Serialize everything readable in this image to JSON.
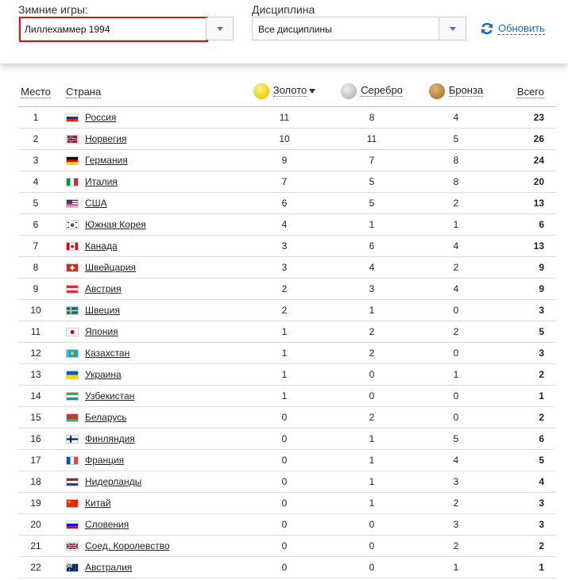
{
  "filters": {
    "games_label": "Зимние игры:",
    "games_value": "Лиллехаммер 1994",
    "discipline_label": "Дисциплина",
    "discipline_value": "Все дисциплины",
    "refresh_label": "Обновить"
  },
  "table": {
    "headers": {
      "place": "Место",
      "country": "Страна",
      "gold": "Золото",
      "silver": "Серебро",
      "bronze": "Бронза",
      "total": "Всего"
    },
    "rows": [
      {
        "place": "1",
        "country": "Россия",
        "flag": "russia",
        "gold": "11",
        "silver": "8",
        "bronze": "4",
        "total": "23"
      },
      {
        "place": "2",
        "country": "Норвегия",
        "flag": "norway",
        "gold": "10",
        "silver": "11",
        "bronze": "5",
        "total": "26"
      },
      {
        "place": "3",
        "country": "Германия",
        "flag": "germany",
        "gold": "9",
        "silver": "7",
        "bronze": "8",
        "total": "24"
      },
      {
        "place": "4",
        "country": "Италия",
        "flag": "italy",
        "gold": "7",
        "silver": "5",
        "bronze": "8",
        "total": "20"
      },
      {
        "place": "5",
        "country": "США",
        "flag": "usa",
        "gold": "6",
        "silver": "5",
        "bronze": "2",
        "total": "13"
      },
      {
        "place": "6",
        "country": "Южная Корея",
        "flag": "south-korea",
        "gold": "4",
        "silver": "1",
        "bronze": "1",
        "total": "6"
      },
      {
        "place": "7",
        "country": "Канада",
        "flag": "canada",
        "gold": "3",
        "silver": "6",
        "bronze": "4",
        "total": "13"
      },
      {
        "place": "8",
        "country": "Швейцария",
        "flag": "switzerland",
        "gold": "3",
        "silver": "4",
        "bronze": "2",
        "total": "9"
      },
      {
        "place": "9",
        "country": "Австрия",
        "flag": "austria",
        "gold": "2",
        "silver": "3",
        "bronze": "4",
        "total": "9"
      },
      {
        "place": "10",
        "country": "Швеция",
        "flag": "sweden",
        "gold": "2",
        "silver": "1",
        "bronze": "0",
        "total": "3"
      },
      {
        "place": "11",
        "country": "Япония",
        "flag": "japan",
        "gold": "1",
        "silver": "2",
        "bronze": "2",
        "total": "5"
      },
      {
        "place": "12",
        "country": "Казахстан",
        "flag": "kazakhstan",
        "gold": "1",
        "silver": "2",
        "bronze": "0",
        "total": "3"
      },
      {
        "place": "13",
        "country": "Украина",
        "flag": "ukraine",
        "gold": "1",
        "silver": "0",
        "bronze": "1",
        "total": "2"
      },
      {
        "place": "14",
        "country": "Узбекистан",
        "flag": "uzbekistan",
        "gold": "1",
        "silver": "0",
        "bronze": "0",
        "total": "1"
      },
      {
        "place": "15",
        "country": "Беларусь",
        "flag": "belarus",
        "gold": "0",
        "silver": "2",
        "bronze": "0",
        "total": "2"
      },
      {
        "place": "16",
        "country": "Финляндия",
        "flag": "finland",
        "gold": "0",
        "silver": "1",
        "bronze": "5",
        "total": "6"
      },
      {
        "place": "17",
        "country": "Франция",
        "flag": "france",
        "gold": "0",
        "silver": "1",
        "bronze": "4",
        "total": "5"
      },
      {
        "place": "18",
        "country": "Нидерланды",
        "flag": "netherlands",
        "gold": "0",
        "silver": "1",
        "bronze": "3",
        "total": "4"
      },
      {
        "place": "19",
        "country": "Китай",
        "flag": "china",
        "gold": "0",
        "silver": "1",
        "bronze": "2",
        "total": "3"
      },
      {
        "place": "20",
        "country": "Словения",
        "flag": "slovenia",
        "gold": "0",
        "silver": "0",
        "bronze": "3",
        "total": "3"
      },
      {
        "place": "21",
        "country": "Соед. Королевство",
        "flag": "uk",
        "gold": "0",
        "silver": "0",
        "bronze": "2",
        "total": "2"
      },
      {
        "place": "22",
        "country": "Австралия",
        "flag": "australia",
        "gold": "0",
        "silver": "0",
        "bronze": "1",
        "total": "1"
      }
    ]
  },
  "colors": {
    "link": "#1a6fb7",
    "highlight_border": "#e0141c",
    "gold": "#f2d21c",
    "silver": "#c3c3c3",
    "bronze": "#b88644"
  }
}
